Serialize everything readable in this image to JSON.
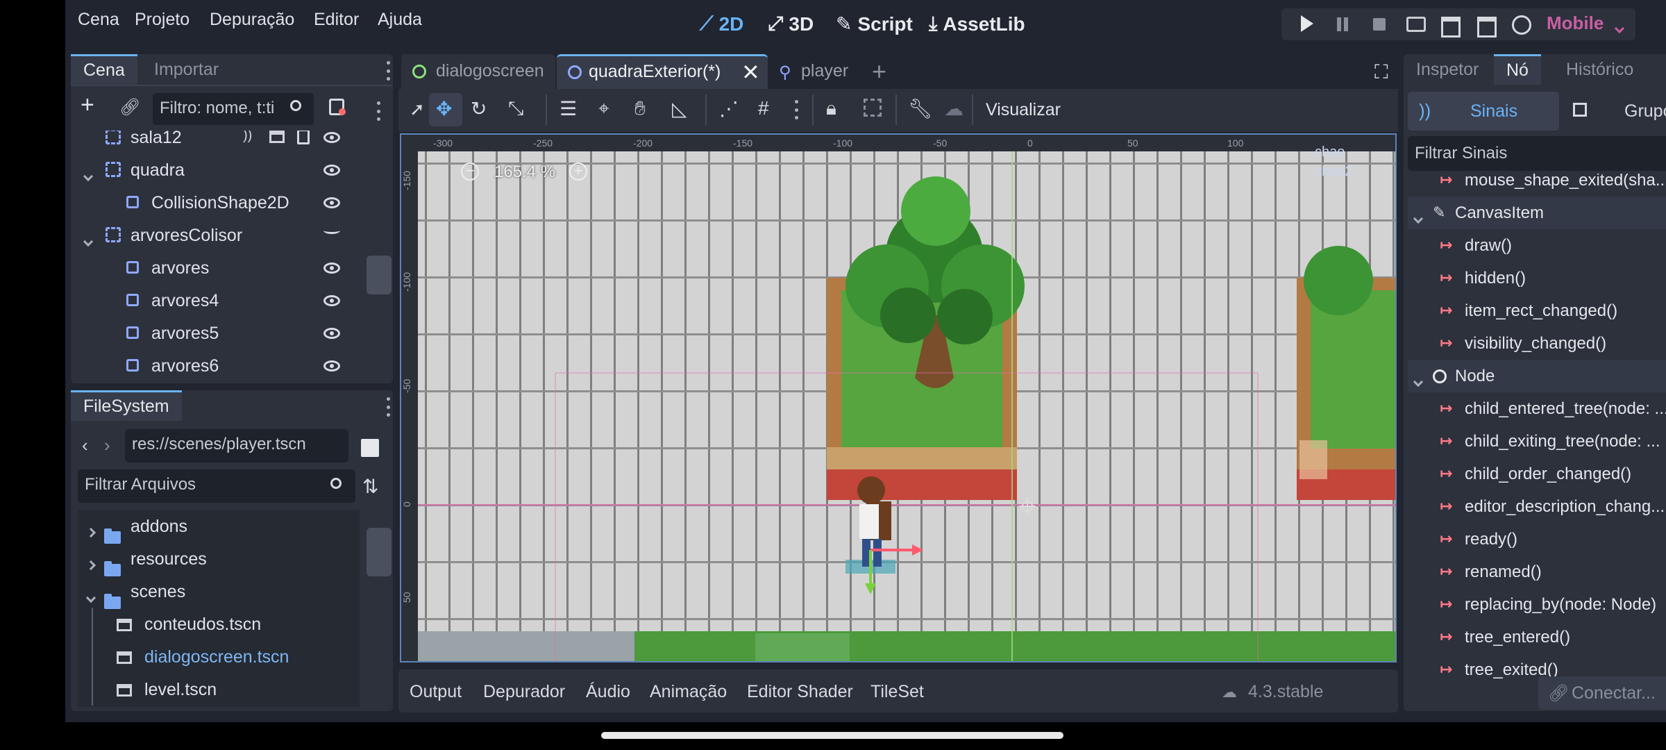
{
  "menu": [
    "Cena",
    "Projeto",
    "Depuração",
    "Editor",
    "Ajuda"
  ],
  "workspaces": {
    "twod": "2D",
    "threed": "3D",
    "script": "Script",
    "assetlib": "AssetLib"
  },
  "renderer": "Mobile",
  "scene_dock": {
    "tabs": [
      "Cena",
      "Importar"
    ],
    "filter_placeholder": "Filtro: nome, t:ti",
    "nodes": [
      {
        "name": "sala12",
        "indent": 1,
        "type": "node2d",
        "icons": true,
        "visibility": "visible"
      },
      {
        "name": "quadra",
        "indent": 1,
        "type": "node2d",
        "expand": "down",
        "visibility": "visible"
      },
      {
        "name": "CollisionShape2D",
        "indent": 2,
        "type": "shape",
        "visibility": "visible"
      },
      {
        "name": "arvoresColisor",
        "indent": 1,
        "type": "node2d",
        "expand": "down",
        "visibility": "hidden"
      },
      {
        "name": "arvores",
        "indent": 2,
        "type": "shape",
        "visibility": "visible"
      },
      {
        "name": "arvores4",
        "indent": 2,
        "type": "shape",
        "visibility": "visible"
      },
      {
        "name": "arvores5",
        "indent": 2,
        "type": "shape",
        "visibility": "visible"
      },
      {
        "name": "arvores6",
        "indent": 2,
        "type": "shape",
        "visibility": "visible"
      }
    ]
  },
  "filesystem": {
    "title": "FileSystem",
    "path": "res://scenes/player.tscn",
    "filter_placeholder": "Filtrar Arquivos",
    "items": [
      {
        "name": "addons",
        "kind": "folder",
        "indent": 1
      },
      {
        "name": "resources",
        "kind": "folder",
        "indent": 1
      },
      {
        "name": "scenes",
        "kind": "folder-open",
        "indent": 1
      },
      {
        "name": "conteudos.tscn",
        "kind": "scene",
        "indent": 2
      },
      {
        "name": "dialogoscreen.tscn",
        "kind": "scene",
        "indent": 2,
        "highlight": true
      },
      {
        "name": "level.tscn",
        "kind": "scene",
        "indent": 2
      }
    ]
  },
  "editor_tabs": [
    {
      "label": "dialogoscreen",
      "active": false
    },
    {
      "label": "quadraExterior(*)",
      "active": true
    },
    {
      "label": "player",
      "active": false
    }
  ],
  "toolbar": {
    "view_label": "Visualizar"
  },
  "viewport": {
    "zoom": "165.4 %",
    "ruler_top": [
      "-300",
      "-250",
      "-200",
      "-150",
      "-100",
      "-50",
      "0",
      "50",
      "100"
    ],
    "ruler_left": [
      "-150",
      "-100",
      "-50",
      "0",
      "50"
    ],
    "corner_labels": [
      "chao",
      "chao2"
    ]
  },
  "bottom_tabs": [
    "Output",
    "Depurador",
    "Áudio",
    "Animação",
    "Editor Shader",
    "TileSet"
  ],
  "version": "4.3.stable",
  "inspector": {
    "tabs": [
      "Inspetor",
      "Nó",
      "Histórico"
    ],
    "subtabs": {
      "signals": "Sinais",
      "groups": "Grupos"
    },
    "filter_placeholder": "Filtrar Sinais",
    "rows": [
      {
        "kind": "signal",
        "text": "mouse_shape_exited(sha..."
      },
      {
        "kind": "class",
        "text": "CanvasItem"
      },
      {
        "kind": "signal",
        "text": "draw()"
      },
      {
        "kind": "signal",
        "text": "hidden()"
      },
      {
        "kind": "signal",
        "text": "item_rect_changed()"
      },
      {
        "kind": "signal",
        "text": "visibility_changed()"
      },
      {
        "kind": "class",
        "text": "Node"
      },
      {
        "kind": "signal",
        "text": "child_entered_tree(node: ..."
      },
      {
        "kind": "signal",
        "text": "child_exiting_tree(node: ..."
      },
      {
        "kind": "signal",
        "text": "child_order_changed()"
      },
      {
        "kind": "signal",
        "text": "editor_description_chang..."
      },
      {
        "kind": "signal",
        "text": "ready()"
      },
      {
        "kind": "signal",
        "text": "renamed()"
      },
      {
        "kind": "signal",
        "text": "replacing_by(node: Node)"
      },
      {
        "kind": "signal",
        "text": "tree_entered()"
      },
      {
        "kind": "signal",
        "text": "tree_exited()"
      }
    ],
    "connect_label": "Conectar..."
  },
  "colors": {
    "accent": "#6ab3f6",
    "renderer": "#c85fa1",
    "signal": "#ff7a85",
    "panel": "#2c313c",
    "base": "#212530"
  }
}
